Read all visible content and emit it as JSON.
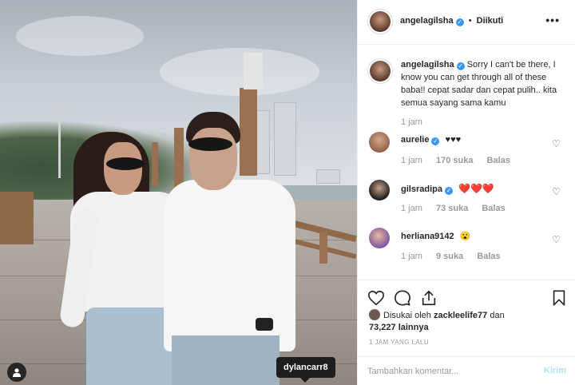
{
  "post": {
    "tag": {
      "username": "dylancarr8"
    }
  },
  "author": {
    "username": "angelagilsha",
    "follow_sep": "•",
    "follow_status": "Diikuti",
    "more": "•••"
  },
  "caption": {
    "username": "angelagilsha",
    "text": "Sorry I can't be there, I know you can get through all of these baba!! cepat sadar dan cepat pulih.. kita semua sayang sama kamu",
    "time": "1 jam"
  },
  "comments": [
    {
      "username": "aurelie",
      "verified": true,
      "text": "♥♥♥",
      "time": "1 jam",
      "likes": "170 suka",
      "reply": "Balas",
      "avatar_color": "#b48466"
    },
    {
      "username": "gilsradipa",
      "verified": true,
      "text": "❤️❤️❤️",
      "time": "1 jam",
      "likes": "73 suka",
      "reply": "Balas",
      "avatar_color": "#2b2b2b"
    },
    {
      "username": "herliana9142",
      "verified": false,
      "text": "😮",
      "time": "1 jam",
      "likes": "9 suka",
      "reply": "Balas",
      "avatar_color": "#7a4f9c"
    }
  ],
  "likes": {
    "prefix": "Disukai oleh",
    "user": "zackleelife77",
    "joiner": "dan",
    "count": "73,227 lainnya"
  },
  "timestamp": "1 JAM YANG LALU",
  "comment_box": {
    "placeholder": "Tambahkan komentar...",
    "post_label": "Kirim"
  },
  "icons": {
    "like": "heart-icon",
    "comment": "comment-icon",
    "share": "share-icon",
    "save": "bookmark-icon",
    "user_tag": "user-icon"
  },
  "colors": {
    "verified": "#3897f0",
    "muted": "#999999",
    "post_button": "#b2dffc",
    "heart_red": "#e0162b"
  }
}
